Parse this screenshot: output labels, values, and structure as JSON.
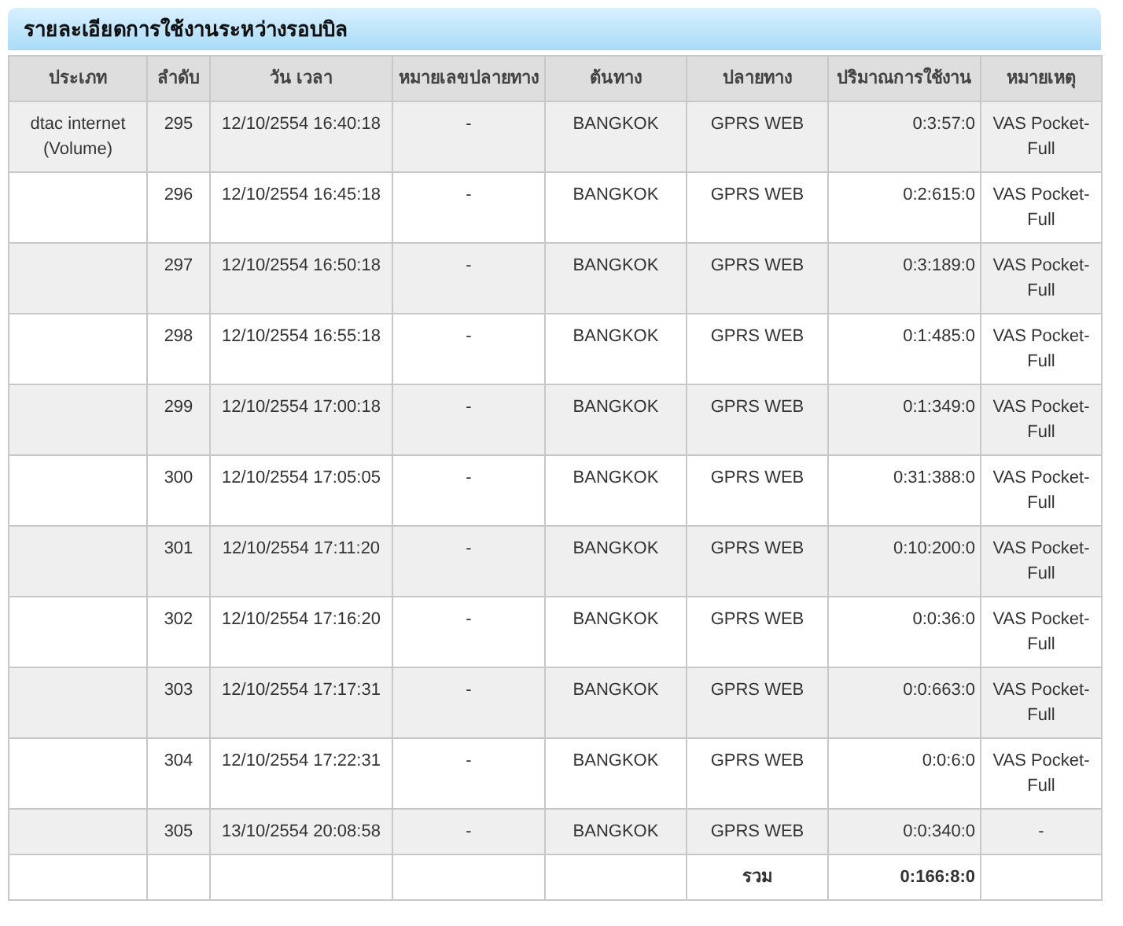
{
  "panel": {
    "title": "รายละเอียดการใช้งานระหว่างรอบบิล"
  },
  "table": {
    "columns": [
      "ประเภท",
      "ลำดับ",
      "วัน เวลา",
      "หมายเลขปลายทาง",
      "ต้นทาง",
      "ปลายทาง",
      "ปริมาณการใช้งาน",
      "หมายเหตุ"
    ],
    "rows": [
      {
        "type": "dtac internet (Volume)",
        "seq": "295",
        "datetime": "12/10/2554 16:40:18",
        "dest_number": "-",
        "origin": "BANGKOK",
        "destination": "GPRS WEB",
        "usage": "0:3:57:0",
        "note": "VAS Pocket-Full"
      },
      {
        "seq": "296",
        "datetime": "12/10/2554 16:45:18",
        "dest_number": "-",
        "origin": "BANGKOK",
        "destination": "GPRS WEB",
        "usage": "0:2:615:0",
        "note": "VAS Pocket-Full"
      },
      {
        "seq": "297",
        "datetime": "12/10/2554 16:50:18",
        "dest_number": "-",
        "origin": "BANGKOK",
        "destination": "GPRS WEB",
        "usage": "0:3:189:0",
        "note": "VAS Pocket-Full"
      },
      {
        "seq": "298",
        "datetime": "12/10/2554 16:55:18",
        "dest_number": "-",
        "origin": "BANGKOK",
        "destination": "GPRS WEB",
        "usage": "0:1:485:0",
        "note": "VAS Pocket-Full"
      },
      {
        "seq": "299",
        "datetime": "12/10/2554 17:00:18",
        "dest_number": "-",
        "origin": "BANGKOK",
        "destination": "GPRS WEB",
        "usage": "0:1:349:0",
        "note": "VAS Pocket-Full"
      },
      {
        "seq": "300",
        "datetime": "12/10/2554 17:05:05",
        "dest_number": "-",
        "origin": "BANGKOK",
        "destination": "GPRS WEB",
        "usage": "0:31:388:0",
        "note": "VAS Pocket-Full"
      },
      {
        "seq": "301",
        "datetime": "12/10/2554 17:11:20",
        "dest_number": "-",
        "origin": "BANGKOK",
        "destination": "GPRS WEB",
        "usage": "0:10:200:0",
        "note": "VAS Pocket-Full"
      },
      {
        "seq": "302",
        "datetime": "12/10/2554 17:16:20",
        "dest_number": "-",
        "origin": "BANGKOK",
        "destination": "GPRS WEB",
        "usage": "0:0:36:0",
        "note": "VAS Pocket-Full"
      },
      {
        "seq": "303",
        "datetime": "12/10/2554 17:17:31",
        "dest_number": "-",
        "origin": "BANGKOK",
        "destination": "GPRS WEB",
        "usage": "0:0:663:0",
        "note": "VAS Pocket-Full"
      },
      {
        "seq": "304",
        "datetime": "12/10/2554 17:22:31",
        "dest_number": "-",
        "origin": "BANGKOK",
        "destination": "GPRS WEB",
        "usage": "0:0:6:0",
        "note": "VAS Pocket-Full"
      },
      {
        "seq": "305",
        "datetime": "13/10/2554 20:08:58",
        "dest_number": "-",
        "origin": "BANGKOK",
        "destination": "GPRS WEB",
        "usage": "0:0:340:0",
        "note": "-"
      }
    ],
    "total": {
      "label": "รวม",
      "value": "0:166:8:0"
    }
  }
}
